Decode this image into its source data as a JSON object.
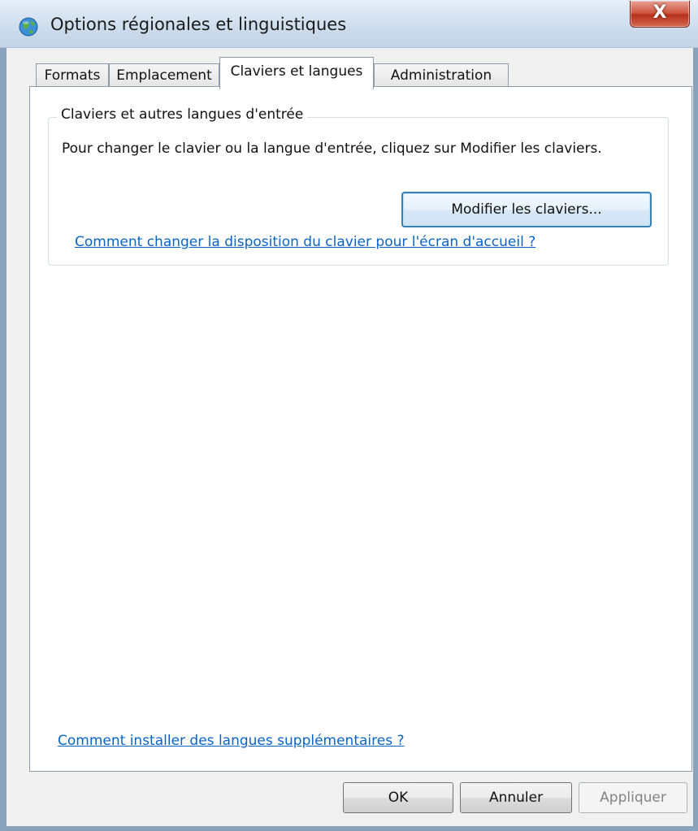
{
  "window": {
    "title": "Options régionales et linguistiques",
    "close_glyph": "X"
  },
  "tabs": [
    {
      "label": "Formats",
      "active": false
    },
    {
      "label": "Emplacement",
      "active": false
    },
    {
      "label": "Claviers et langues",
      "active": true
    },
    {
      "label": "Administration",
      "active": false
    }
  ],
  "group": {
    "title": "Claviers et autres langues d'entrée",
    "description": "Pour changer le clavier ou la langue d'entrée, cliquez sur Modifier les claviers.",
    "button_label": "Modifier les claviers...",
    "link_label": "Comment changer la disposition du clavier pour l'écran d'accueil ?"
  },
  "footer_link": "Comment installer des langues supplémentaires ?",
  "buttons": {
    "ok": "OK",
    "cancel": "Annuler",
    "apply": "Appliquer",
    "apply_enabled": false
  },
  "colors": {
    "link": "#0a64c8",
    "close_button": "#c7432c",
    "focused_button_border": "#3c7fb1"
  },
  "icons": {
    "app": "globe-icon",
    "close": "close-icon"
  }
}
